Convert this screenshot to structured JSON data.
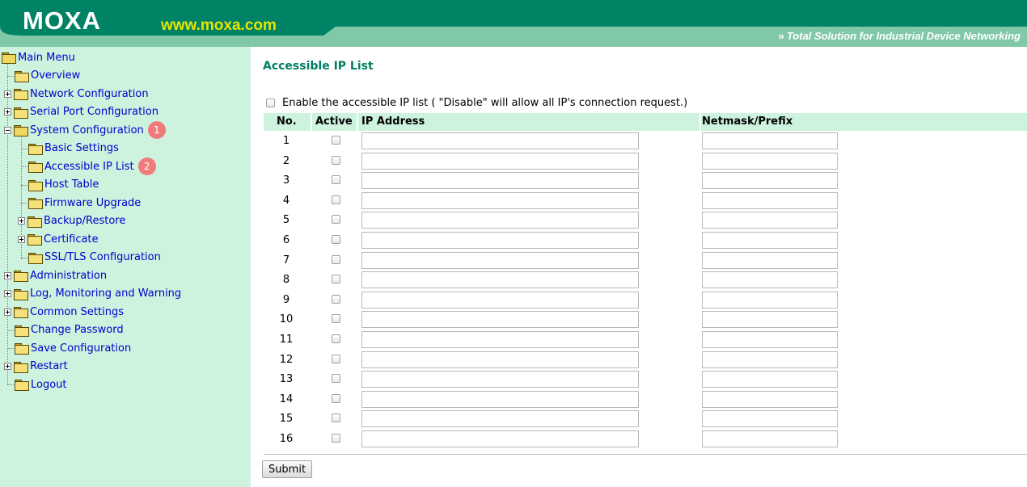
{
  "header": {
    "logo": "MOXA",
    "website": "www.moxa.com",
    "tagline": "Total Solution for Industrial Device Networking",
    "tagline_icon": "double-chevron-icon",
    "colors": {
      "primary": "#008264",
      "secondary": "#80c8a8",
      "website": "#e6e600"
    }
  },
  "sidebar": {
    "background": "#cdf2dd",
    "items": [
      {
        "label": "Main Menu",
        "level": 0,
        "expander": "none",
        "folder": "open-folder-icon"
      },
      {
        "label": "Overview",
        "level": 1,
        "expander": "none",
        "folder": "folder-icon"
      },
      {
        "label": "Network Configuration",
        "level": 1,
        "expander": "plus",
        "folder": "folder-icon"
      },
      {
        "label": "Serial Port Configuration",
        "level": 1,
        "expander": "plus",
        "folder": "folder-icon"
      },
      {
        "label": "System Configuration",
        "level": 1,
        "expander": "minus",
        "folder": "open-folder-icon",
        "badge": "1"
      },
      {
        "label": "Basic Settings",
        "level": 2,
        "expander": "none",
        "folder": "folder-icon"
      },
      {
        "label": "Accessible IP List",
        "level": 2,
        "expander": "none",
        "folder": "folder-icon",
        "badge": "2"
      },
      {
        "label": "Host Table",
        "level": 2,
        "expander": "none",
        "folder": "folder-icon"
      },
      {
        "label": "Firmware Upgrade",
        "level": 2,
        "expander": "none",
        "folder": "folder-icon"
      },
      {
        "label": "Backup/Restore",
        "level": 2,
        "expander": "plus",
        "folder": "folder-icon"
      },
      {
        "label": "Certificate",
        "level": 2,
        "expander": "plus",
        "folder": "folder-icon"
      },
      {
        "label": "SSL/TLS Configuration",
        "level": 2,
        "expander": "none",
        "folder": "folder-icon"
      },
      {
        "label": "Administration",
        "level": 1,
        "expander": "plus",
        "folder": "folder-icon"
      },
      {
        "label": "Log, Monitoring and Warning",
        "level": 1,
        "expander": "plus",
        "folder": "folder-icon"
      },
      {
        "label": "Common Settings",
        "level": 1,
        "expander": "plus",
        "folder": "folder-icon"
      },
      {
        "label": "Change Password",
        "level": 1,
        "expander": "none",
        "folder": "folder-icon"
      },
      {
        "label": "Save Configuration",
        "level": 1,
        "expander": "none",
        "folder": "folder-icon"
      },
      {
        "label": "Restart",
        "level": 1,
        "expander": "plus",
        "folder": "folder-icon"
      },
      {
        "label": "Logout",
        "level": 1,
        "expander": "none",
        "folder": "folder-icon"
      }
    ]
  },
  "main": {
    "title": "Accessible IP List",
    "title_color": "#007f62",
    "enable_checkbox": {
      "checked": false,
      "label": "Enable the accessible IP list ( \"Disable\" will allow all IP's connection request.)"
    },
    "table": {
      "columns": [
        "No.",
        "Active",
        "IP Address",
        "Netmask/Prefix"
      ],
      "header_background": "#cdf2dd",
      "rows": [
        {
          "no": "1",
          "active": false,
          "ip": "",
          "netmask": ""
        },
        {
          "no": "2",
          "active": false,
          "ip": "",
          "netmask": ""
        },
        {
          "no": "3",
          "active": false,
          "ip": "",
          "netmask": ""
        },
        {
          "no": "4",
          "active": false,
          "ip": "",
          "netmask": ""
        },
        {
          "no": "5",
          "active": false,
          "ip": "",
          "netmask": ""
        },
        {
          "no": "6",
          "active": false,
          "ip": "",
          "netmask": ""
        },
        {
          "no": "7",
          "active": false,
          "ip": "",
          "netmask": ""
        },
        {
          "no": "8",
          "active": false,
          "ip": "",
          "netmask": ""
        },
        {
          "no": "9",
          "active": false,
          "ip": "",
          "netmask": ""
        },
        {
          "no": "10",
          "active": false,
          "ip": "",
          "netmask": ""
        },
        {
          "no": "11",
          "active": false,
          "ip": "",
          "netmask": ""
        },
        {
          "no": "12",
          "active": false,
          "ip": "",
          "netmask": ""
        },
        {
          "no": "13",
          "active": false,
          "ip": "",
          "netmask": ""
        },
        {
          "no": "14",
          "active": false,
          "ip": "",
          "netmask": ""
        },
        {
          "no": "15",
          "active": false,
          "ip": "",
          "netmask": ""
        },
        {
          "no": "16",
          "active": false,
          "ip": "",
          "netmask": ""
        }
      ]
    },
    "submit_label": "Submit"
  }
}
